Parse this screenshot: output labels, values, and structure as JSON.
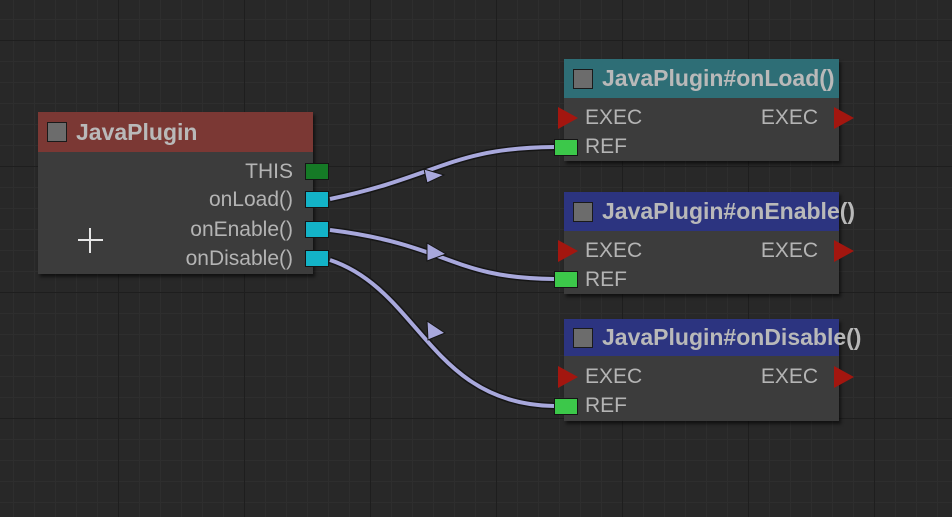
{
  "colors": {
    "source_header": "#7b3834",
    "onload_header": "#2e6e76",
    "onenable_header": "#2c3480",
    "ondisable_header": "#2c3480",
    "wire": "#a8a8dc",
    "exec_pin": "#a3160f",
    "this_pin": "#157a26",
    "method_pin": "#13b3c7",
    "ref_pin": "#3cc84a"
  },
  "source_node": {
    "title": "JavaPlugin",
    "pins": {
      "this": "THIS",
      "on_load": "onLoad()",
      "on_enable": "onEnable()",
      "on_disable": "onDisable()"
    }
  },
  "target_nodes": [
    {
      "title": "JavaPlugin#onLoad()",
      "exec_in": "EXEC",
      "exec_out": "EXEC",
      "ref": "REF"
    },
    {
      "title": "JavaPlugin#onEnable()",
      "exec_in": "EXEC",
      "exec_out": "EXEC",
      "ref": "REF"
    },
    {
      "title": "JavaPlugin#onDisable()",
      "exec_in": "EXEC",
      "exec_out": "EXEC",
      "ref": "REF"
    }
  ],
  "connections": [
    {
      "from": "onLoad()",
      "to": "JavaPlugin#onLoad()"
    },
    {
      "from": "onEnable()",
      "to": "JavaPlugin#onEnable()"
    },
    {
      "from": "onDisable()",
      "to": "JavaPlugin#onDisable()"
    }
  ]
}
